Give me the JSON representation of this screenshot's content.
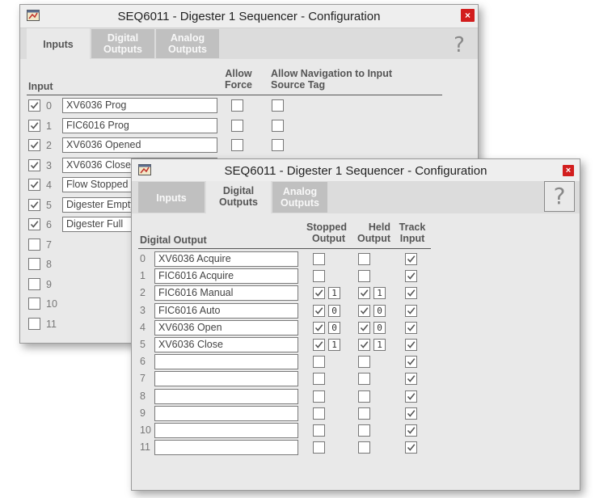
{
  "window_inputs": {
    "title": "SEQ6011 - Digester 1 Sequencer - Configuration",
    "close_label": "×",
    "help_label": "?",
    "tabs": [
      {
        "label": "Inputs",
        "active": true
      },
      {
        "label": "Digital Outputs",
        "active": false
      },
      {
        "label": "Analog Outputs",
        "active": false
      }
    ],
    "col_input": "Input",
    "col_allow_force": "Allow Force",
    "col_allow_nav": "Allow Navigation to Input Source Tag",
    "rows": [
      {
        "index": "0",
        "checked": true,
        "tag": "XV6036 Prog"
      },
      {
        "index": "1",
        "checked": true,
        "tag": "FIC6016 Prog"
      },
      {
        "index": "2",
        "checked": true,
        "tag": "XV6036 Opened"
      },
      {
        "index": "3",
        "checked": true,
        "tag": "XV6036 Close"
      },
      {
        "index": "4",
        "checked": true,
        "tag": "Flow Stopped"
      },
      {
        "index": "5",
        "checked": true,
        "tag": "Digester Empty"
      },
      {
        "index": "6",
        "checked": true,
        "tag": "Digester Full"
      },
      {
        "index": "7",
        "checked": false,
        "tag": ""
      },
      {
        "index": "8",
        "checked": false,
        "tag": ""
      },
      {
        "index": "9",
        "checked": false,
        "tag": ""
      },
      {
        "index": "10",
        "checked": false,
        "tag": ""
      },
      {
        "index": "11",
        "checked": false,
        "tag": ""
      }
    ]
  },
  "window_outputs": {
    "title": "SEQ6011 - Digester 1 Sequencer - Configuration",
    "close_label": "×",
    "help_label": "?",
    "tabs": [
      {
        "label": "Inputs",
        "active": false
      },
      {
        "label": "Digital Outputs",
        "active": true
      },
      {
        "label": "Analog Outputs",
        "active": false
      }
    ],
    "col_digital_output": "Digital Output",
    "col_stopped_output": "Stopped Output",
    "col_held_output": "Held Output",
    "col_track_input": "Track Input",
    "rows": [
      {
        "index": "0",
        "tag": "XV6036 Acquire",
        "stopped": false,
        "stopped_value": "",
        "held": false,
        "held_value": "",
        "track": true
      },
      {
        "index": "1",
        "tag": "FIC6016 Acquire",
        "stopped": false,
        "stopped_value": "",
        "held": false,
        "held_value": "",
        "track": true
      },
      {
        "index": "2",
        "tag": "FIC6016 Manual",
        "stopped": true,
        "stopped_value": "1",
        "held": true,
        "held_value": "1",
        "track": true
      },
      {
        "index": "3",
        "tag": "FIC6016 Auto",
        "stopped": true,
        "stopped_value": "0",
        "held": true,
        "held_value": "0",
        "track": true
      },
      {
        "index": "4",
        "tag": "XV6036 Open",
        "stopped": true,
        "stopped_value": "0",
        "held": true,
        "held_value": "0",
        "track": true
      },
      {
        "index": "5",
        "tag": "XV6036 Close",
        "stopped": true,
        "stopped_value": "1",
        "held": true,
        "held_value": "1",
        "track": true
      },
      {
        "index": "6",
        "tag": "",
        "stopped": false,
        "stopped_value": "",
        "held": false,
        "held_value": "",
        "track": true
      },
      {
        "index": "7",
        "tag": "",
        "stopped": false,
        "stopped_value": "",
        "held": false,
        "held_value": "",
        "track": true
      },
      {
        "index": "8",
        "tag": "",
        "stopped": false,
        "stopped_value": "",
        "held": false,
        "held_value": "",
        "track": true
      },
      {
        "index": "9",
        "tag": "",
        "stopped": false,
        "stopped_value": "",
        "held": false,
        "held_value": "",
        "track": true
      },
      {
        "index": "10",
        "tag": "",
        "stopped": false,
        "stopped_value": "",
        "held": false,
        "held_value": "",
        "track": true
      },
      {
        "index": "11",
        "tag": "",
        "stopped": false,
        "stopped_value": "",
        "held": false,
        "held_value": "",
        "track": true
      }
    ]
  },
  "colors": {
    "window_bg": "#e9e9e9",
    "tab_inactive": "#c0c0c0",
    "close_red": "#d21d1d"
  }
}
